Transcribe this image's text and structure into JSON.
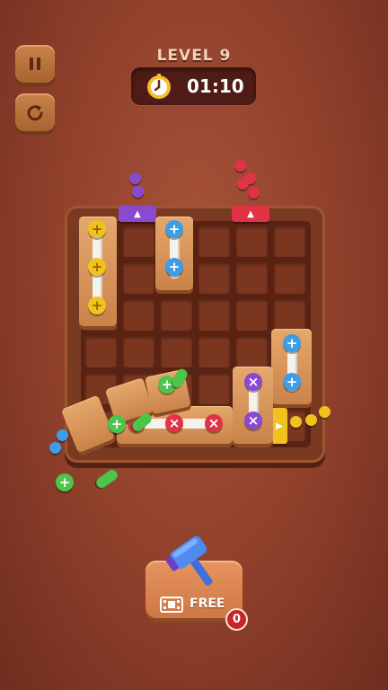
{
  "header": {
    "level_label": "LEVEL 9",
    "timer": "01:10"
  },
  "controls": {
    "pause_icon": "pause-icon",
    "restart_icon": "restart-icon"
  },
  "booster": {
    "label": "FREE",
    "count": "0",
    "icon": "hammer-icon",
    "video_icon": "film-icon"
  },
  "colors": {
    "yellow": "#f1c21d",
    "blue": "#3d9ee6",
    "purple": "#8a4ad0",
    "red": "#e23246",
    "green": "#4cc54a"
  },
  "exits": {
    "purple": "up",
    "red": "up",
    "yellow": "right"
  }
}
